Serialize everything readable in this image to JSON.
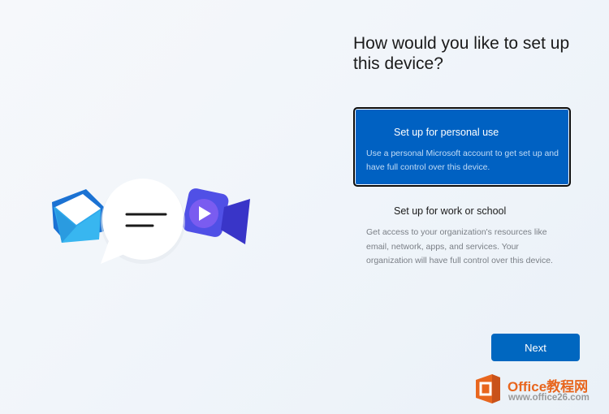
{
  "setup": {
    "title": "How would you like to set up this device?",
    "options": [
      {
        "title": "Set up for personal use",
        "description": "Use a personal Microsoft account to get set up and have full control over this device.",
        "selected": true
      },
      {
        "title": "Set up for work or school",
        "description": "Get access to your organization's resources like email, network, apps, and services. Your organization will have full control over this device.",
        "selected": false
      }
    ],
    "next_label": "Next"
  },
  "illustration": {
    "icons": [
      "mail-envelope-icon",
      "chat-bubble-icon",
      "video-camera-icon"
    ],
    "colors": {
      "envelope": "#2b91e3",
      "bubble": "#ffffff",
      "camera": "#4a47e0"
    }
  },
  "watermark": {
    "name": "Office教程网",
    "url": "www.office26.com",
    "icon": "office-logo-icon"
  },
  "colors": {
    "accent": "#0067c0",
    "selected_card": "#0061c2",
    "background": "#f3f6fa"
  }
}
